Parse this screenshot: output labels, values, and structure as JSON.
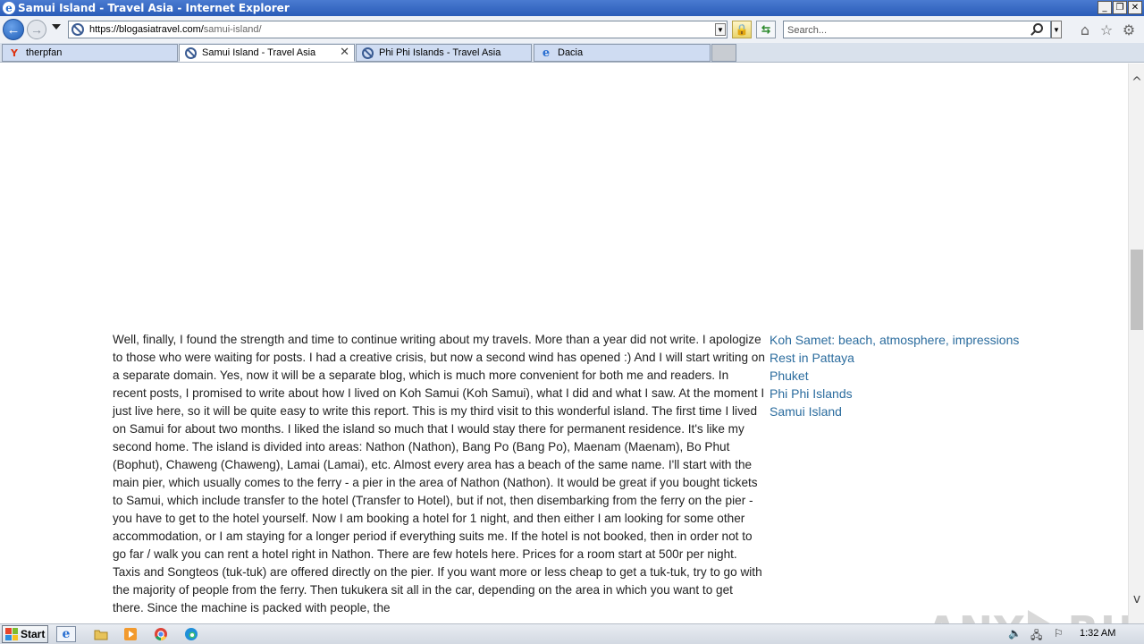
{
  "window": {
    "title": "Samui Island - Travel Asia - Internet Explorer",
    "minimize_glyph": "_",
    "restore_glyph": "❐",
    "close_glyph": "✕"
  },
  "navigation": {
    "back_glyph": "←",
    "forward_glyph": "→",
    "url_host": "https://blogasiatravel.com/",
    "url_path": "samui-island/",
    "search_placeholder": "Search...",
    "lock_glyph": "🔒",
    "refresh_glyph": "⇆",
    "dropdown_glyph": "▼",
    "home_glyph": "⌂",
    "favorites_glyph": "☆",
    "settings_glyph": "⚙"
  },
  "tabs": [
    {
      "label": "therpfan",
      "icon": "yandex-icon",
      "active": false
    },
    {
      "label": "Samui Island - Travel Asia",
      "icon": "blocked-icon",
      "active": true
    },
    {
      "label": "Phi Phi Islands - Travel Asia",
      "icon": "blocked-icon",
      "active": false
    },
    {
      "label": "Dacia",
      "icon": "ie-icon",
      "active": false
    }
  ],
  "tab_close_glyph": "✕",
  "article": {
    "body": "Well, finally, I found the strength and time to continue writing about my travels. More than a year did not write. I apologize to those who were waiting for posts. I had a creative crisis, but now a second wind has opened :) And I will start writing on a separate domain. Yes, now it will be a separate blog, which is much more convenient for both me and readers. In recent posts, I promised to write about how I lived on Koh Samui (Koh Samui), what I did and what I saw. At the moment I just live here, so it will be quite easy to write this report. This is my third visit to this wonderful island. The first time I lived on Samui for about two months. I liked the island so much that I would stay there for permanent residence. It's like my second home. The island is divided into areas: Nathon (Nathon), Bang Po (Bang Po), Maenam (Maenam), Bo Phut (Bophut), Chaweng (Chaweng), Lamai (Lamai), etc. Almost every area has a beach of the same name. I'll start with the main pier, which usually comes to the ferry - a pier in the area of Nathon (Nathon). It would be great if you bought tickets to Samui, which include transfer to the hotel (Transfer to Hotel), but if not, then disembarking from the ferry on the pier - you have to get to the hotel yourself. Now I am booking a hotel for 1 night, and then either I am looking for some other accommodation, or I am staying for a longer period if everything suits me. If the hotel is not booked, then in order not to go far / walk you can rent a hotel right in Nathon. There are few hotels here. Prices for a room start at 500r per night. Taxis and Songteos (tuk-tuk) are offered directly on the pier. If you want more or less cheap to get a tuk-tuk, try to go with the majority of people from the ferry. Then tukukera sit all in the car, depending on the area in which you want to get there. Since the machine is packed with people, the"
  },
  "sidebar": {
    "links": [
      "Koh Samet: beach, atmosphere, impressions",
      "Rest in Pattaya",
      "Phuket",
      "Phi Phi Islands",
      "Samui Island"
    ]
  },
  "scrollbar": {
    "up_glyph": "^",
    "down_glyph": "v",
    "position_fraction": 0.38
  },
  "watermark": {
    "left": "ANY",
    "right": "RUN"
  },
  "taskbar": {
    "start_label": "Start",
    "clock": "1:32 AM",
    "speaker_glyph": "🔈",
    "network_glyph": "🖧",
    "flag_glyph": "⚐"
  },
  "colors": {
    "link": "#2b6c9e",
    "titlebar": "#2a5cb8",
    "text": "#222222"
  }
}
